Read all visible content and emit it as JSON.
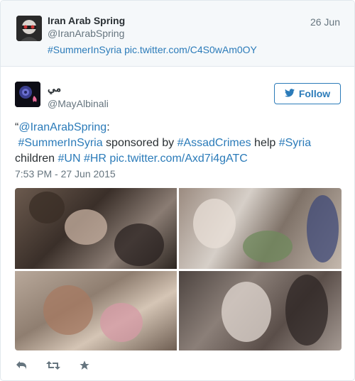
{
  "quoted": {
    "name": "Iran Arab Spring",
    "handle": "@IranArabSpring",
    "date": "26 Jun",
    "text": "#SummerInSyria pic.twitter.com/C4S0wAm0OY"
  },
  "tweet": {
    "name": "مي",
    "handle": "@MayAlbinali",
    "follow_label": "Follow",
    "text_quote_open": "“",
    "text_mention": "@IranArabSpring",
    "text_colon": ":",
    "text_hashtag_summer": "#SummerInSyria",
    "text_sponsored": " sponsored by ",
    "text_hashtag_assad": "#AssadCrimes",
    "text_help": " help ",
    "text_hashtag_syria": "#Syria",
    "text_children": "children ",
    "text_hashtag_un": "#UN",
    "text_hashtag_hr": "#HR",
    "text_pic_link": "pic.twitter.com/Axd7i4gATC",
    "timestamp": "7:53 PM - 27 Jun 2015"
  },
  "actions": {
    "icons": [
      "reply-icon",
      "retweet-icon",
      "favorite-icon"
    ]
  },
  "colors": {
    "link": "#2b7bb9",
    "secondary_text": "#66757f",
    "border": "#e1e8ed",
    "quoted_bg": "#f5f8fa"
  }
}
